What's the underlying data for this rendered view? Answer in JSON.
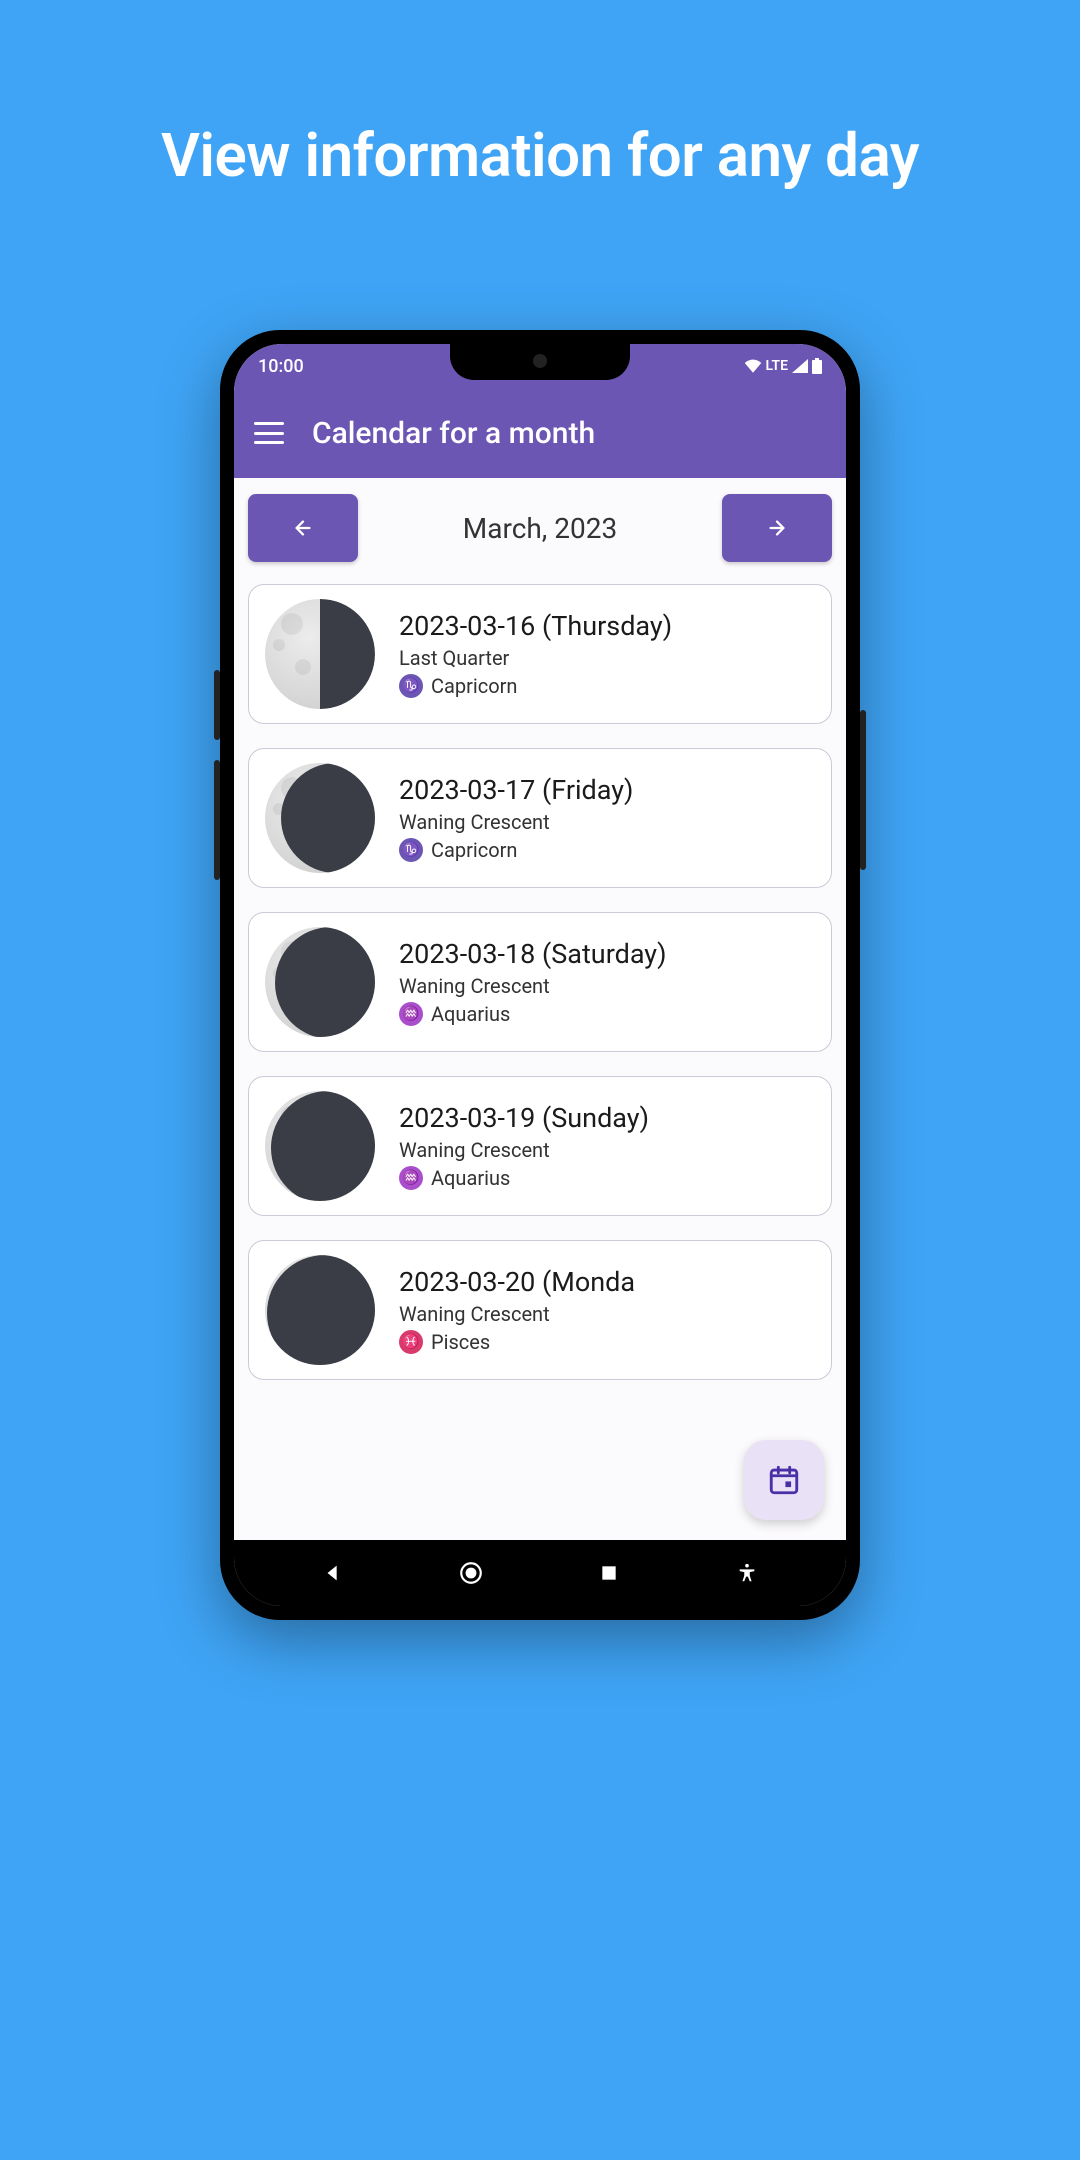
{
  "hero": {
    "text": "View information for any day"
  },
  "status": {
    "time": "10:00",
    "network_label": "LTE"
  },
  "appbar": {
    "title": "Calendar for a month"
  },
  "month_nav": {
    "label": "March, 2023"
  },
  "days": [
    {
      "date": "2023-03-16 (Thursday)",
      "phase": "Last Quarter",
      "zodiac": "Capricorn",
      "zodiac_glyph": "♑",
      "zodiac_class": "zodiac-purple",
      "moon_class": "phase-lastquarter"
    },
    {
      "date": "2023-03-17 (Friday)",
      "phase": "Waning Crescent",
      "zodiac": "Capricorn",
      "zodiac_glyph": "♑",
      "zodiac_class": "zodiac-purple",
      "moon_class": "phase-waningcrescent"
    },
    {
      "date": "2023-03-18 (Saturday)",
      "phase": "Waning Crescent",
      "zodiac": "Aquarius",
      "zodiac_glyph": "♒",
      "zodiac_class": "zodiac-violet",
      "moon_class": "phase-waningcrescent-2"
    },
    {
      "date": "2023-03-19 (Sunday)",
      "phase": "Waning Crescent",
      "zodiac": "Aquarius",
      "zodiac_glyph": "♒",
      "zodiac_class": "zodiac-violet",
      "moon_class": "phase-waningcrescent-3"
    },
    {
      "date": "2023-03-20 (Monda",
      "phase": "Waning Crescent",
      "zodiac": "Pisces",
      "zodiac_glyph": "♓",
      "zodiac_class": "zodiac-pink",
      "moon_class": "phase-waningcrescent-4"
    }
  ]
}
